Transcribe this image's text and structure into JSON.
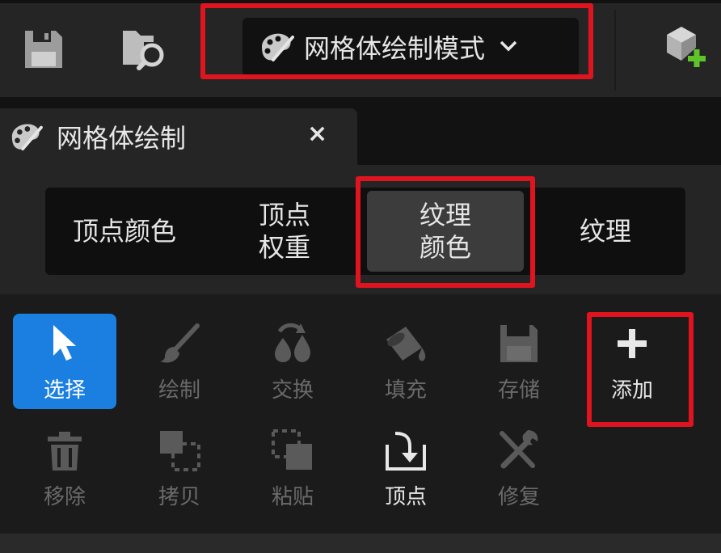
{
  "toolbar": {
    "save_icon": "save-icon",
    "browse_icon": "folder-search-icon",
    "mode_icon": "paint-palette-icon",
    "mode_label": "网格体绘制模式",
    "mode_chevron": "chevron-down-icon",
    "add_actor_icon": "add-actor-icon"
  },
  "tab": {
    "icon": "paint-palette-icon",
    "label": "网格体绘制",
    "close": "×"
  },
  "segmented": {
    "items": [
      {
        "label": "顶点颜色",
        "active": false
      },
      {
        "label": "顶点\n权重",
        "active": false
      },
      {
        "label": "纹理\n颜色",
        "active": true
      },
      {
        "label": "纹理",
        "active": false
      }
    ]
  },
  "tools": {
    "row1": [
      {
        "label": "选择",
        "icon": "cursor-arrow-icon",
        "state": "selected"
      },
      {
        "label": "绘制",
        "icon": "brush-icon",
        "state": "disabled"
      },
      {
        "label": "交换",
        "icon": "swap-drops-icon",
        "state": "disabled"
      },
      {
        "label": "填充",
        "icon": "paint-bucket-icon",
        "state": "disabled"
      },
      {
        "label": "存储",
        "icon": "save-icon",
        "state": "disabled"
      },
      {
        "label": "添加",
        "icon": "plus-icon",
        "state": "enabled"
      }
    ],
    "row2": [
      {
        "label": "移除",
        "icon": "trash-icon",
        "state": "disabled"
      },
      {
        "label": "拷贝",
        "icon": "copy-icon",
        "state": "disabled"
      },
      {
        "label": "粘贴",
        "icon": "paste-icon",
        "state": "disabled"
      },
      {
        "label": "顶点",
        "icon": "import-vertex-icon",
        "state": "enabled"
      },
      {
        "label": "修复",
        "icon": "repair-tools-icon",
        "state": "disabled"
      }
    ]
  },
  "colors": {
    "highlight": "#e0141e",
    "selected": "#1a7fe0",
    "add_green": "#5ec429"
  }
}
